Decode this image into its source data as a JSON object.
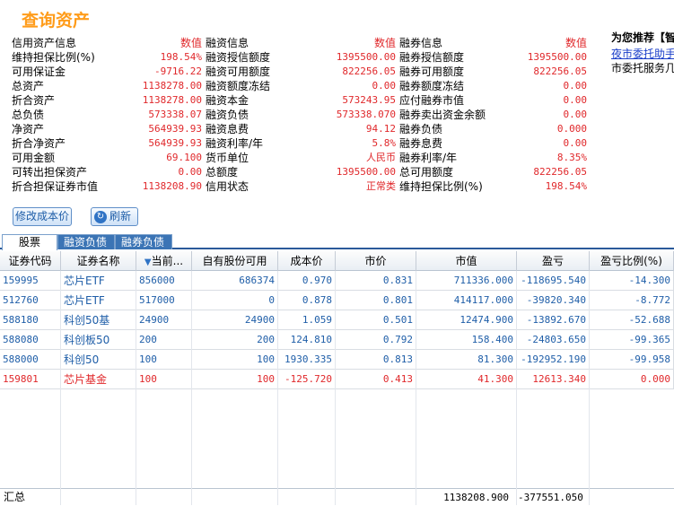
{
  "title": "查询资产",
  "info": {
    "col1": [
      {
        "label": "信用资产信息",
        "value": "数值"
      },
      {
        "label": "维持担保比例(%)",
        "value": "198.54%"
      },
      {
        "label": "可用保证金",
        "value": "-9716.22"
      },
      {
        "label": "总资产",
        "value": "1138278.00"
      },
      {
        "label": "折合资产",
        "value": "1138278.00"
      },
      {
        "label": "总负债",
        "value": "573338.07"
      },
      {
        "label": "净资产",
        "value": "564939.93"
      },
      {
        "label": "折合净资产",
        "value": "564939.93"
      },
      {
        "label": "可用金额",
        "value": "69.100"
      },
      {
        "label": "可转出担保资产",
        "value": "0.00"
      },
      {
        "label": "折合担保证券市值",
        "value": "1138208.90"
      }
    ],
    "col2": [
      {
        "label": "融资信息",
        "value": "数值"
      },
      {
        "label": "融资授信额度",
        "value": "1395500.00"
      },
      {
        "label": "融资可用额度",
        "value": "822256.05"
      },
      {
        "label": "融资额度冻结",
        "value": "0.00"
      },
      {
        "label": "融资本金",
        "value": "573243.95"
      },
      {
        "label": "融资负债",
        "value": "573338.070"
      },
      {
        "label": "融资息费",
        "value": "94.12"
      },
      {
        "label": "融资利率/年",
        "value": "5.8%"
      },
      {
        "label": "货币单位",
        "value": "人民币"
      },
      {
        "label": "总额度",
        "value": "1395500.00"
      },
      {
        "label": "信用状态",
        "value": "正常类"
      }
    ],
    "col3": [
      {
        "label": "融券信息",
        "value": "数值"
      },
      {
        "label": "融券授信额度",
        "value": "1395500.00"
      },
      {
        "label": "融券可用额度",
        "value": "822256.05"
      },
      {
        "label": "融券额度冻结",
        "value": "0.00"
      },
      {
        "label": "应付融券市值",
        "value": "0.00"
      },
      {
        "label": "融券卖出资金余额",
        "value": "0.00"
      },
      {
        "label": "融券负债",
        "value": "0.000"
      },
      {
        "label": "融券息费",
        "value": "0.00"
      },
      {
        "label": "融券利率/年",
        "value": "8.35%"
      },
      {
        "label": "总可用额度",
        "value": "822256.05"
      },
      {
        "label": "维持担保比例(%)",
        "value": "198.54%"
      }
    ]
  },
  "side": {
    "recommend": "为您推荐【智",
    "link": "夜市委托助手",
    "text": "市委托服务几"
  },
  "buttons": {
    "modify": "修改成本价",
    "refresh": "刷新"
  },
  "tabs": [
    "股票",
    "融资负债",
    "融券负债"
  ],
  "table": {
    "headers": [
      "证券代码",
      "证券名称",
      "当前...",
      "自有股份可用",
      "成本价",
      "市价",
      "市值",
      "盈亏",
      "盈亏比例(%)"
    ],
    "rows": [
      {
        "code": "159995",
        "name": "芯片ETF",
        "qty": "856000",
        "avail": "686374",
        "cost": "0.970",
        "price": "0.831",
        "mv": "711336.000",
        "pl": "-118695.540",
        "plr": "-14.300",
        "color": "blue"
      },
      {
        "code": "512760",
        "name": "芯片ETF",
        "qty": "517000",
        "avail": "0",
        "cost": "0.878",
        "price": "0.801",
        "mv": "414117.000",
        "pl": "-39820.340",
        "plr": "-8.772",
        "color": "blue"
      },
      {
        "code": "588180",
        "name": "科创50基",
        "qty": "24900",
        "avail": "24900",
        "cost": "1.059",
        "price": "0.501",
        "mv": "12474.900",
        "pl": "-13892.670",
        "plr": "-52.688",
        "color": "blue"
      },
      {
        "code": "588080",
        "name": "科创板50",
        "qty": "200",
        "avail": "200",
        "cost": "124.810",
        "price": "0.792",
        "mv": "158.400",
        "pl": "-24803.650",
        "plr": "-99.365",
        "color": "blue"
      },
      {
        "code": "588000",
        "name": "科创50",
        "qty": "100",
        "avail": "100",
        "cost": "1930.335",
        "price": "0.813",
        "mv": "81.300",
        "pl": "-192952.190",
        "plr": "-99.958",
        "color": "blue"
      },
      {
        "code": "159801",
        "name": "芯片基金",
        "qty": "100",
        "avail": "100",
        "cost": "-125.720",
        "price": "0.413",
        "mv": "41.300",
        "pl": "12613.340",
        "plr": "0.000",
        "color": "red"
      }
    ],
    "total": {
      "label": "汇总",
      "mv": "1138208.900",
      "pl": "-377551.050"
    }
  }
}
